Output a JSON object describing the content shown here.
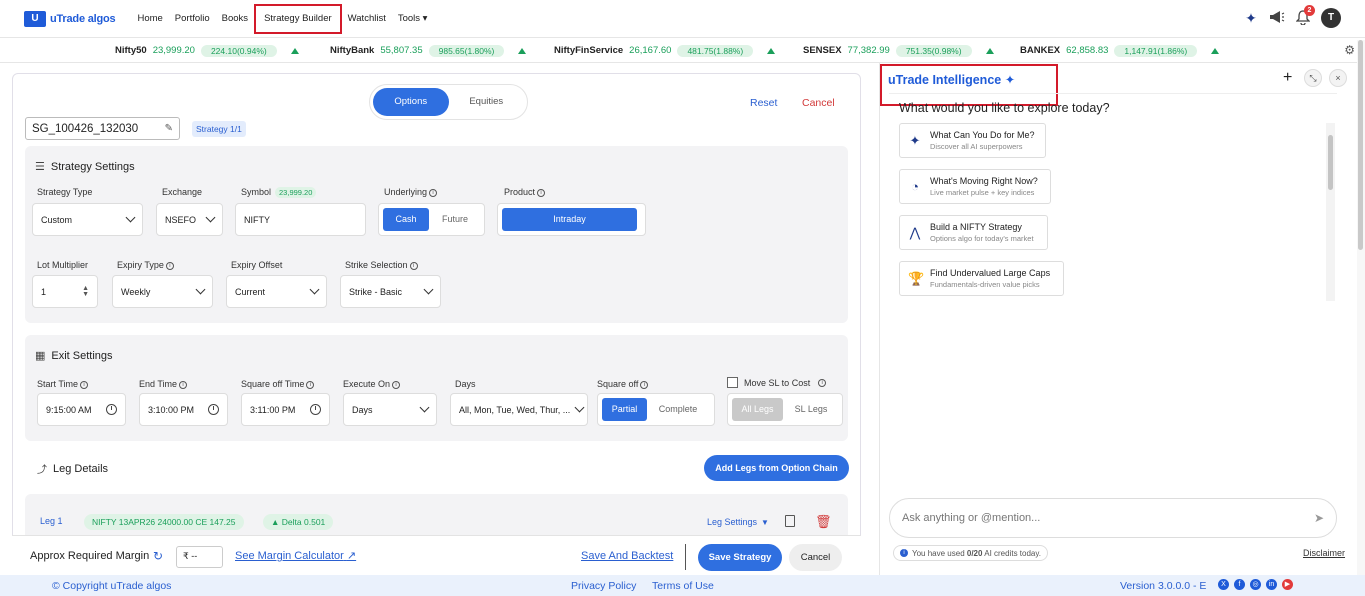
{
  "brand": {
    "logo_text": "uTrade algos",
    "logo_mark": "U"
  },
  "nav": {
    "items": [
      "Home",
      "Portfolio",
      "Books",
      "Strategy Builder",
      "Watchlist",
      "Tools"
    ],
    "tools_chevron": "▾",
    "notifications_count": "2",
    "avatar_initial": "T"
  },
  "ticker": [
    {
      "name": "Nifty50",
      "value": "23,999.20",
      "change": "224.10(0.94%)"
    },
    {
      "name": "NiftyBank",
      "value": "55,807.35",
      "change": "985.65(1.80%)"
    },
    {
      "name": "NiftyFinService",
      "value": "26,167.60",
      "change": "481.75(1.88%)"
    },
    {
      "name": "SENSEX",
      "value": "77,382.99",
      "change": "751.35(0.98%)"
    },
    {
      "name": "BANKEX",
      "value": "62,858.83",
      "change": "1,147.91(1.86%)"
    }
  ],
  "builder": {
    "tabs": [
      "Options",
      "Equities"
    ],
    "reset": "Reset",
    "cancel": "Cancel",
    "strategy_name": "SG_100426_132030",
    "strategy_badge": "Strategy 1/1",
    "settings": {
      "title": "Strategy Settings",
      "strategy_type_label": "Strategy Type",
      "strategy_type": "Custom",
      "exchange_label": "Exchange",
      "exchange": "NSEFO",
      "symbol_label": "Symbol",
      "symbol_badge": "23,999.20",
      "symbol": "NIFTY",
      "underlying_label": "Underlying",
      "underlying_opts": [
        "Cash",
        "Future"
      ],
      "product_label": "Product",
      "product": "Intraday",
      "lot_mult_label": "Lot Multiplier",
      "lot_mult": "1",
      "expiry_type_label": "Expiry Type",
      "expiry_type": "Weekly",
      "expiry_offset_label": "Expiry Offset",
      "expiry_offset": "Current",
      "strike_sel_label": "Strike Selection",
      "strike_sel": "Strike - Basic"
    },
    "exit": {
      "title": "Exit Settings",
      "start_label": "Start Time",
      "start": "9:15:00 AM",
      "end_label": "End Time",
      "end": "3:10:00 PM",
      "sq_time_label": "Square off Time",
      "sq_time": "3:11:00 PM",
      "exec_label": "Execute On",
      "exec": "Days",
      "days_label": "Days",
      "days": "All, Mon, Tue, Wed, Thur, ...",
      "sqoff_label": "Square off",
      "sqoff_opts": [
        "Partial",
        "Complete"
      ],
      "move_sl_label": "Move SL to Cost",
      "legs_opts": [
        "All Legs",
        "SL Legs"
      ]
    },
    "legs": {
      "title": "Leg Details",
      "add_btn": "Add Legs from Option Chain",
      "leg_label": "Leg 1",
      "leg_instrument": "NIFTY 13APR26 24000.00 CE 147.25",
      "leg_delta": "Delta 0.501",
      "leg_settings": "Leg Settings"
    },
    "bottom": {
      "margin_label": "Approx Required Margin",
      "margin_value": "₹ --",
      "margin_calc": "See Margin Calculator",
      "save_backtest": "Save And Backtest",
      "save": "Save Strategy",
      "cancel": "Cancel"
    }
  },
  "ai": {
    "title": "uTrade Intelligence",
    "question": "What would you like to explore today?",
    "cards": [
      {
        "title": "What Can You Do for Me?",
        "sub": "Discover all AI superpowers",
        "icon": "sparkle-icon"
      },
      {
        "title": "What's Moving Right Now?",
        "sub": "Live market pulse + key indices",
        "icon": "gauge-icon"
      },
      {
        "title": "Build a NIFTY Strategy",
        "sub": "Options algo for today's market",
        "icon": "compass-icon"
      },
      {
        "title": "Find Undervalued Large Caps",
        "sub": "Fundamentals-driven value picks",
        "icon": "trophy-icon"
      }
    ],
    "input_placeholder": "Ask anything or @mention...",
    "credits_prefix": "You have used ",
    "credits_count": "0/20",
    "credits_suffix": " AI credits today.",
    "disclaimer": "Disclaimer"
  },
  "footer": {
    "copyright": "© Copyright uTrade algos",
    "privacy": "Privacy Policy",
    "terms": "Terms of Use",
    "version": "Version 3.0.0.0 - E"
  },
  "colors": {
    "brand": "#1f5bd8",
    "primary": "#2f6fe0",
    "positive": "#1a9f5a",
    "danger": "#d23a3a",
    "highlight": "#d31a2a"
  }
}
